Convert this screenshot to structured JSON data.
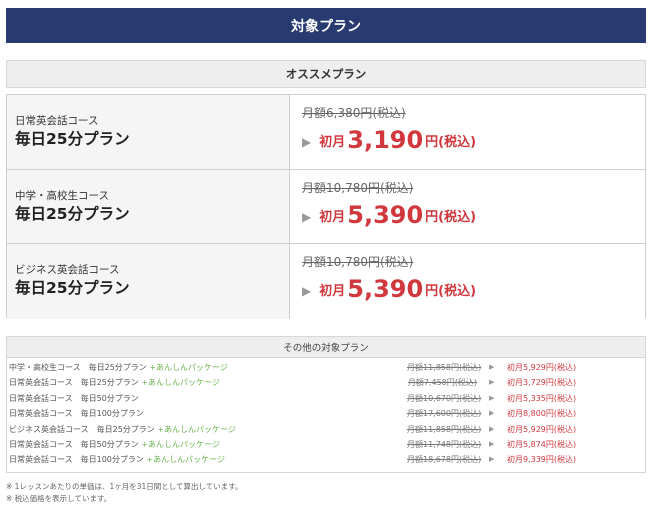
{
  "header": {
    "title": "対象プラン"
  },
  "recommended": {
    "title": "オススメプラン",
    "rows": [
      {
        "course": "日常英会話コース",
        "plan": "毎日25分プラン",
        "regular": "月額6,380円(税込)",
        "first_label": "初月",
        "amount": "3,190",
        "unit": "円(税込)"
      },
      {
        "course": "中学・高校生コース",
        "plan": "毎日25分プラン",
        "regular": "月額10,780円(税込)",
        "first_label": "初月",
        "amount": "5,390",
        "unit": "円(税込)"
      },
      {
        "course": "ビジネス英会話コース",
        "plan": "毎日25分プラン",
        "regular": "月額10,780円(税込)",
        "first_label": "初月",
        "amount": "5,390",
        "unit": "円(税込)"
      }
    ]
  },
  "other": {
    "title": "その他の対象プラン",
    "rows": [
      {
        "course": "中学・高校生コース　毎日25分プラン",
        "package": "+あんしんパッケージ",
        "regular": "月額11,858円(税込)",
        "offer": "初月5,929円(税込)"
      },
      {
        "course": "日常英会話コース　毎日25分プラン",
        "package": "+あんしんパッケージ",
        "regular": "月額7,458円(税込)",
        "offer": "初月3,729円(税込)"
      },
      {
        "course": "日常英会話コース　毎日50分プラン",
        "package": "",
        "regular": "月額10,670円(税込)",
        "offer": "初月5,335円(税込)"
      },
      {
        "course": "日常英会話コース　毎日100分プラン",
        "package": "",
        "regular": "月額17,600円(税込)",
        "offer": "初月8,800円(税込)"
      },
      {
        "course": "ビジネス英会話コース　毎日25分プラン",
        "package": "+あんしんパッケージ",
        "regular": "月額11,858円(税込)",
        "offer": "初月5,929円(税込)"
      },
      {
        "course": "日常英会話コース　毎日50分プラン",
        "package": "+あんしんパッケージ",
        "regular": "月額11,748円(税込)",
        "offer": "初月5,874円(税込)"
      },
      {
        "course": "日常英会話コース　毎日100分プラン",
        "package": "+あんしんパッケージ",
        "regular": "月額18,678円(税込)",
        "offer": "初月9,339円(税込)"
      }
    ]
  },
  "notes": [
    "※ 1レッスンあたりの単価は、1ヶ月を31日間として算出しています。",
    "※ 税込価格を表示しています。"
  ],
  "colors": {
    "header_bg": "#283a70",
    "price_red": "#d0383d",
    "package_green": "#6ab04c"
  },
  "icons": {
    "arrow": "triangle-right-icon"
  }
}
